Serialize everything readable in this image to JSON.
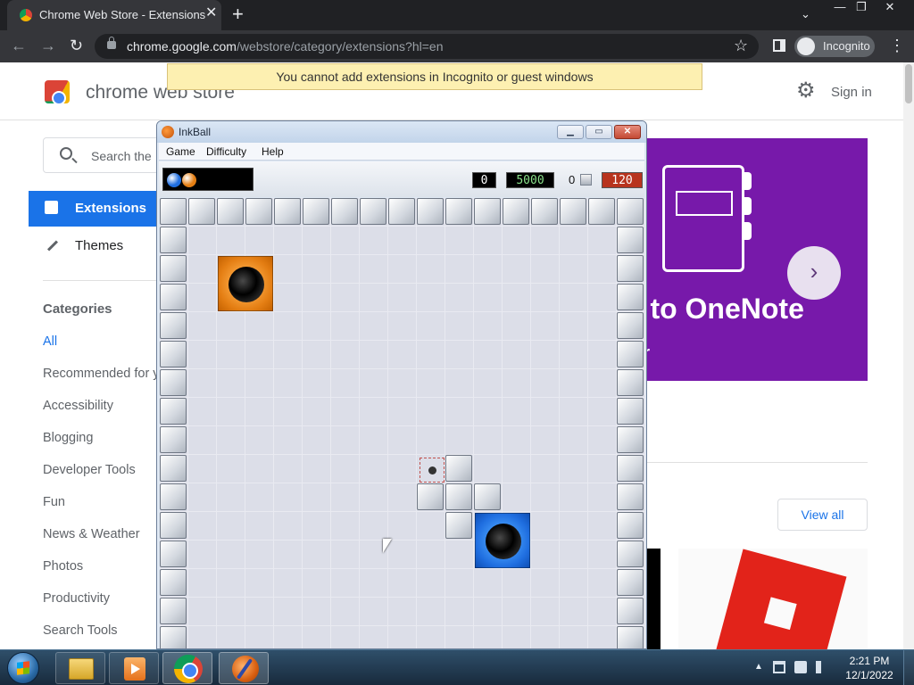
{
  "browser": {
    "tab_title": "Chrome Web Store - Extensions",
    "tab_close": "✕",
    "new_tab": "+",
    "tab_search": "⌄",
    "win_minimize": "—",
    "win_restore": "❐",
    "win_close": "✕",
    "back": "←",
    "forward": "→",
    "reload": "↻",
    "url_host": "chrome.google.com",
    "url_path": "/webstore/category/extensions?hl=en",
    "star": "☆",
    "incognito_label": "Incognito",
    "menu": "⋮"
  },
  "warning": "You cannot add extensions in Incognito or guest windows",
  "store": {
    "title": "chrome web store",
    "gear": "⚙",
    "sign_in": "Sign in",
    "search_placeholder": "Search the",
    "nav": {
      "extensions": "Extensions",
      "themes": "Themes"
    },
    "categories_heading": "Categories",
    "categories": [
      {
        "label": "All",
        "active": true
      },
      {
        "label": "Recommended for y",
        "active": false
      },
      {
        "label": "Accessibility",
        "active": false
      },
      {
        "label": "Blogging",
        "active": false
      },
      {
        "label": "Developer Tools",
        "active": false
      },
      {
        "label": "Fun",
        "active": false
      },
      {
        "label": "News & Weather",
        "active": false
      },
      {
        "label": "Photos",
        "active": false
      },
      {
        "label": "Productivity",
        "active": false
      },
      {
        "label": "Search Tools",
        "active": false
      }
    ],
    "banner": {
      "line1": "o to OneNote",
      "line2": "ber",
      "next": "›",
      "color": "#7719aa"
    },
    "view_all": "View all"
  },
  "inkball": {
    "title": "InkBall",
    "btn_minimize": "▁",
    "btn_maximize": "▭",
    "btn_close": "✕",
    "menu": [
      "Game",
      "Difficulty",
      "Help"
    ],
    "ball_colors": [
      "#1f6ee0",
      "#e47e13"
    ],
    "score_left": "0",
    "score": "5000",
    "gray_count": "0",
    "timer": "120",
    "holes": {
      "orange": "#e47e13",
      "blue": "#1f6ee0"
    }
  },
  "taskbar": {
    "apps": [
      "windows-explorer",
      "media-player",
      "google-chrome",
      "inkball"
    ],
    "time": "2:21 PM",
    "date": "12/1/2022",
    "tray_arrow": "▲"
  }
}
